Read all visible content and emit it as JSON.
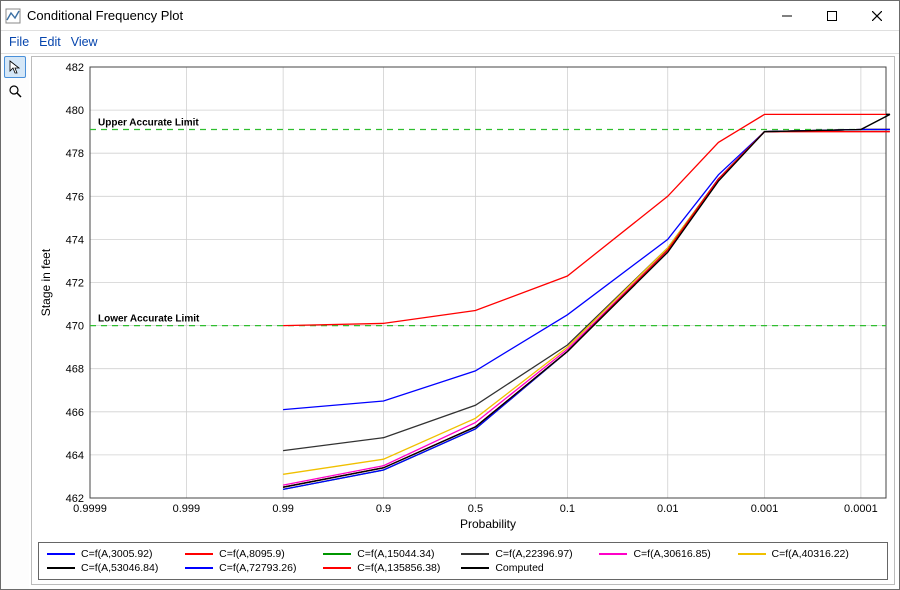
{
  "window": {
    "title": "Conditional Frequency Plot"
  },
  "menu": {
    "file": "File",
    "edit": "Edit",
    "view": "View"
  },
  "tools": {
    "pointer": "pointer",
    "zoom": "zoom"
  },
  "chart_data": {
    "type": "line",
    "xlabel": "Probability",
    "ylabel": "Stage in feet",
    "x_scale": "log_prob",
    "x_ticks": [
      0.9999,
      0.999,
      0.99,
      0.9,
      0.5,
      0.1,
      0.01,
      0.001,
      0.0001
    ],
    "x_tick_labels": [
      "0.9999",
      "0.999",
      "0.99",
      "0.9",
      "0.5",
      "0.1",
      "0.01",
      "0.001",
      "0.0001"
    ],
    "ylim": [
      462,
      482
    ],
    "y_ticks": [
      462,
      464,
      466,
      468,
      470,
      472,
      474,
      476,
      478,
      480,
      482
    ],
    "reference_lines": [
      {
        "label": "Upper Accurate Limit",
        "y": 479.1,
        "color": "#2fbe2f",
        "dash": true
      },
      {
        "label": "Lower Accurate Limit",
        "y": 470.0,
        "color": "#2fbe2f",
        "dash": true
      }
    ],
    "probe_x": [
      0.99,
      0.9,
      0.5,
      0.1,
      0.01,
      0.003,
      0.001,
      0.0001,
      5e-05
    ],
    "series": [
      {
        "name": "C=f(A,3005.92)",
        "color": "#0000ff",
        "y": [
          466.1,
          466.5,
          467.9,
          470.5,
          474.0,
          477.0,
          479.0,
          479.1,
          479.1
        ]
      },
      {
        "name": "C=f(A,8095.9)",
        "color": "#ff0000",
        "y": [
          470.0,
          470.1,
          470.7,
          472.3,
          476.0,
          478.5,
          479.8,
          479.8,
          479.8
        ]
      },
      {
        "name": "C=f(A,15044.34)",
        "color": "#009600",
        "y": [
          462.4,
          463.3,
          465.2,
          468.8,
          473.5,
          476.8,
          479.0,
          479.1,
          479.1
        ]
      },
      {
        "name": "C=f(A,22396.97)",
        "color": "#323232",
        "y": [
          464.2,
          464.8,
          466.3,
          469.1,
          473.6,
          476.8,
          479.0,
          479.1,
          479.8
        ]
      },
      {
        "name": "C=f(A,30616.85)",
        "color": "#ff00c8",
        "y": [
          462.6,
          463.5,
          465.5,
          468.9,
          473.5,
          476.8,
          479.0,
          479.1,
          479.1
        ]
      },
      {
        "name": "C=f(A,40316.22)",
        "color": "#f0c000",
        "y": [
          463.1,
          463.8,
          465.7,
          469.0,
          473.6,
          476.8,
          479.0,
          479.1,
          479.1
        ]
      },
      {
        "name": "C=f(A,53046.84)",
        "color": "#000000",
        "y": [
          462.5,
          463.4,
          465.3,
          468.8,
          473.5,
          476.8,
          479.0,
          479.1,
          479.1
        ]
      },
      {
        "name": "C=f(A,72793.26)",
        "color": "#0000ff",
        "y": [
          462.4,
          463.3,
          465.2,
          468.8,
          473.5,
          476.8,
          479.0,
          479.1,
          479.1
        ]
      },
      {
        "name": "C=f(A,135856.38)",
        "color": "#ff0000",
        "y": [
          462.5,
          463.4,
          465.3,
          468.8,
          473.5,
          476.8,
          479.0,
          479.0,
          479.0
        ]
      },
      {
        "name": "Computed",
        "color": "#000000",
        "y": [
          462.5,
          463.4,
          465.3,
          468.8,
          473.4,
          476.7,
          479.0,
          479.1,
          479.8
        ]
      }
    ]
  }
}
